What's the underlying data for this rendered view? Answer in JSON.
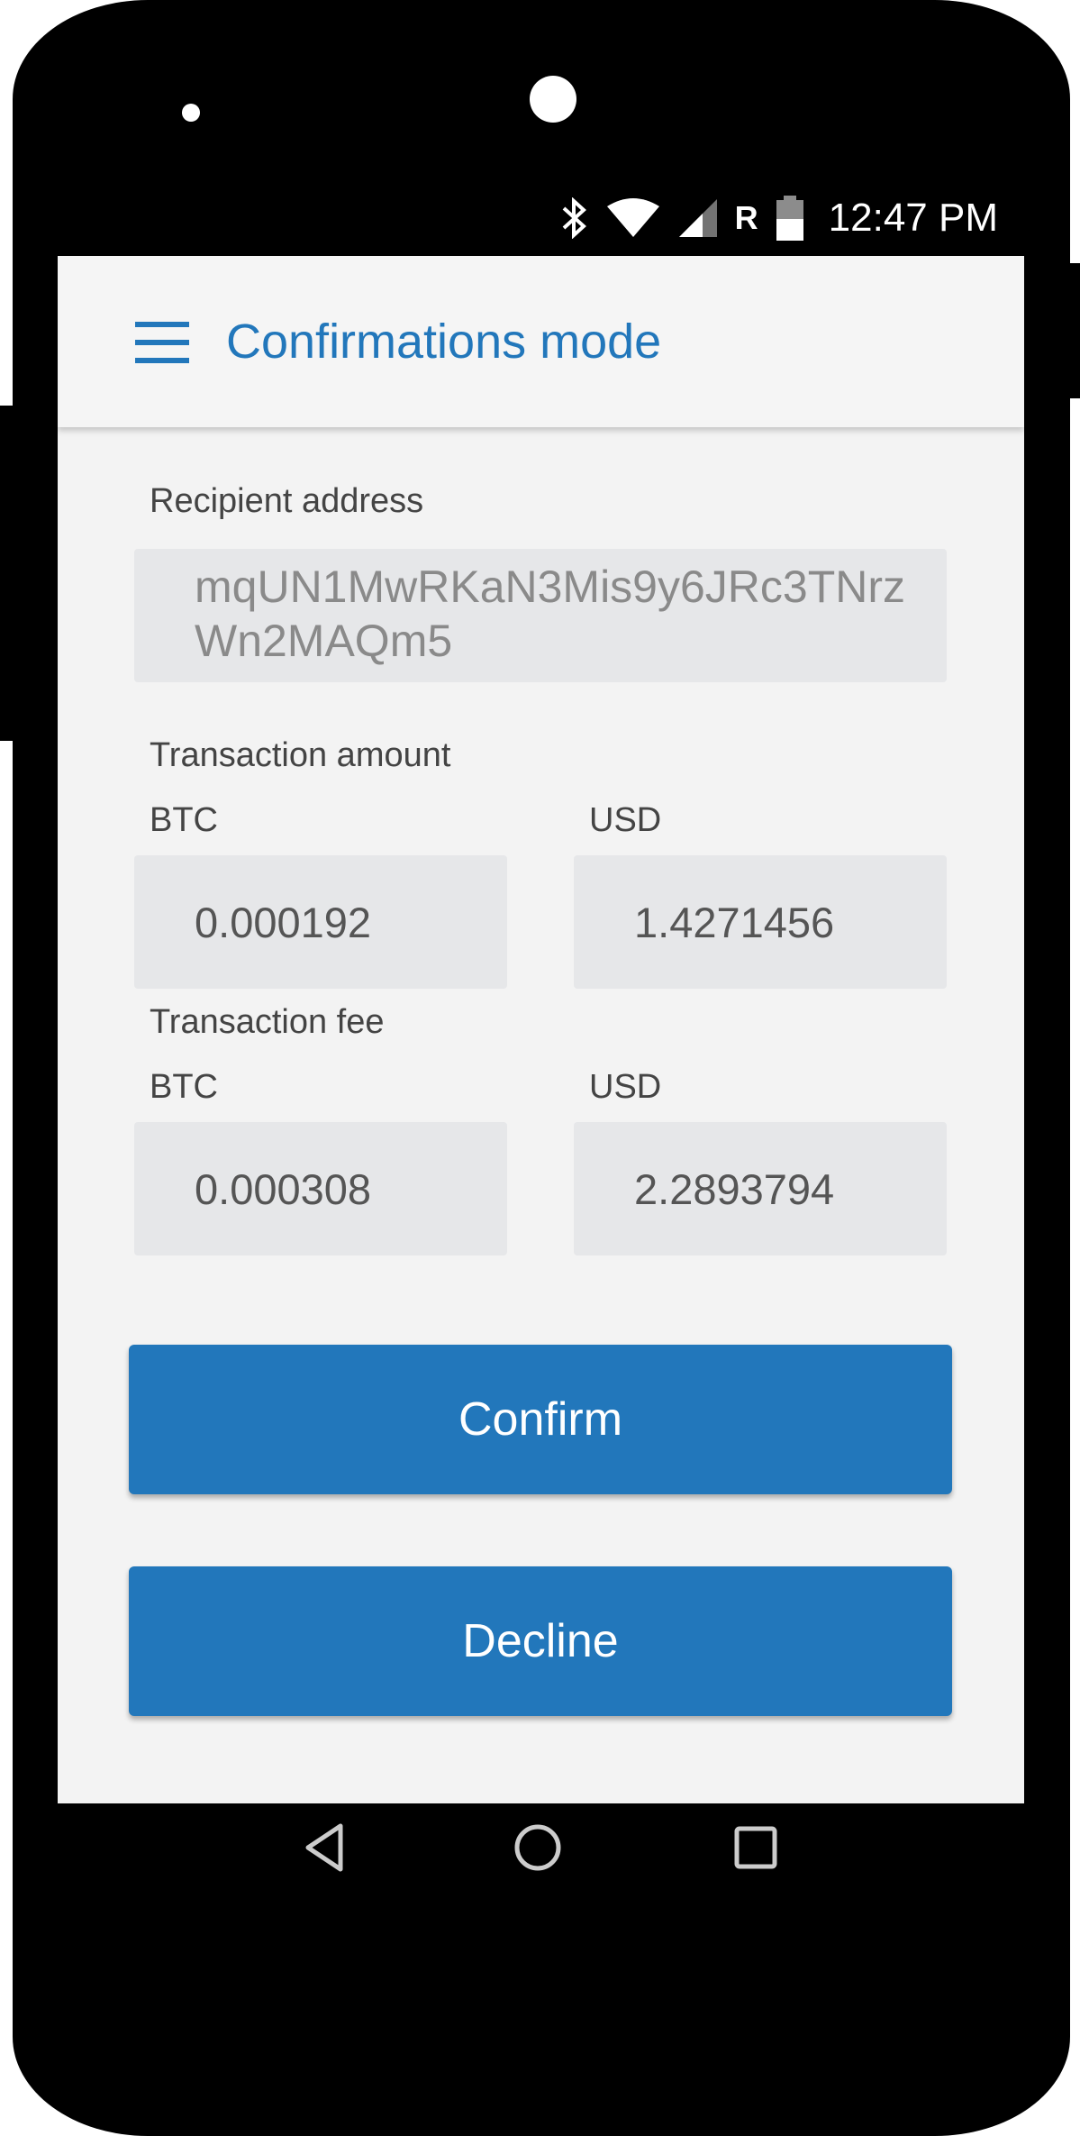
{
  "status_bar": {
    "carrier_indicator": "R",
    "time": "12:47 PM",
    "icons": [
      "bluetooth-icon",
      "wifi-icon",
      "cell-signal-icon",
      "battery-icon"
    ]
  },
  "app_bar": {
    "menu_icon": "hamburger-menu-icon",
    "title": "Confirmations mode"
  },
  "recipient": {
    "label": "Recipient address",
    "value": "mqUN1MwRKaN3Mis9y6JRc3TNrzWn2MAQm5"
  },
  "amount": {
    "label": "Transaction amount",
    "btc_label": "BTC",
    "btc_value": "0.000192",
    "usd_label": "USD",
    "usd_value": "1.4271456"
  },
  "fee": {
    "label": "Transaction fee",
    "btc_label": "BTC",
    "btc_value": "0.000308",
    "usd_label": "USD",
    "usd_value": "2.2893794"
  },
  "actions": {
    "confirm_label": "Confirm",
    "decline_label": "Decline"
  },
  "nav_bar": {
    "icons": [
      "back-icon",
      "home-icon",
      "recents-icon"
    ]
  },
  "colors": {
    "accent": "#2277bb",
    "screen_background": "#f3f3f3",
    "field_background": "#e6e7e9",
    "phone_body": "#000000"
  }
}
